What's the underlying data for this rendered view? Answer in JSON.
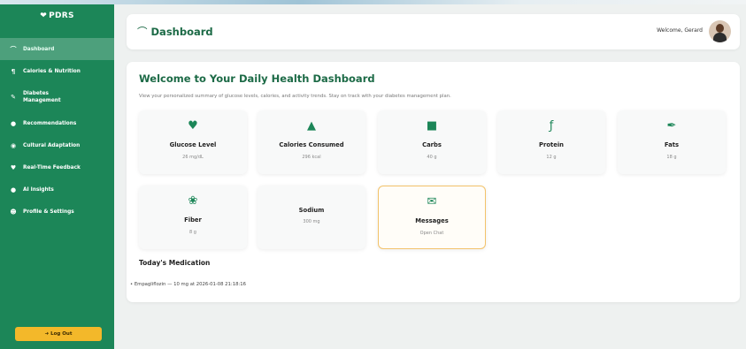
{
  "app": {
    "name": "PDRS"
  },
  "sidebar": {
    "items": [
      {
        "label": "Dashboard",
        "icon": "chart-line-icon",
        "active": true
      },
      {
        "label": "Calories & Nutrition",
        "icon": "utensils-icon"
      },
      {
        "label": "Diabetes Management",
        "icon": "syringe-icon"
      },
      {
        "label": "Recommendations",
        "icon": "lightbulb-icon"
      },
      {
        "label": "Cultural Adaptation",
        "icon": "globe-icon"
      },
      {
        "label": "Real-Time Feedback",
        "icon": "heart-icon"
      },
      {
        "label": "AI Insights",
        "icon": "robot-icon"
      },
      {
        "label": "Profile & Settings",
        "icon": "user-gear-icon"
      }
    ],
    "logout_label": "Log Out"
  },
  "header": {
    "title": "Dashboard",
    "welcome": "Welcome, Gerard"
  },
  "main": {
    "heading": "Welcome to Your Daily Health Dashboard",
    "subtitle": "View your personalized summary of glucose levels, calories, and activity trends. Stay on track with your diabetes management plan."
  },
  "cards": [
    {
      "label": "Glucose Level",
      "value": "26 mg/dL",
      "icon": "heartbeat-icon"
    },
    {
      "label": "Calories Consumed",
      "value": "296 kcal",
      "icon": "fire-icon"
    },
    {
      "label": "Carbs",
      "value": "40 g",
      "icon": "bread-icon"
    },
    {
      "label": "Protein",
      "value": "12 g",
      "icon": "drumstick-icon"
    },
    {
      "label": "Fats",
      "value": "18 g",
      "icon": "feather-icon"
    },
    {
      "label": "Fiber",
      "value": "8 g",
      "icon": "seedling-icon"
    },
    {
      "label": "Sodium",
      "value": "300 mg",
      "icon": "salt-icon"
    },
    {
      "label": "Messages",
      "value": "Open Chat",
      "icon": "envelope-icon"
    }
  ],
  "medication": {
    "title": "Today's Medication",
    "items": [
      "Empagliflozin — 10 mg at 2026-01-08 21:18:16"
    ]
  },
  "colors": {
    "sidebar": "#1c8658",
    "accent": "#1c6a46",
    "logout": "#f3b82a",
    "messages_border": "#f3c36b"
  }
}
